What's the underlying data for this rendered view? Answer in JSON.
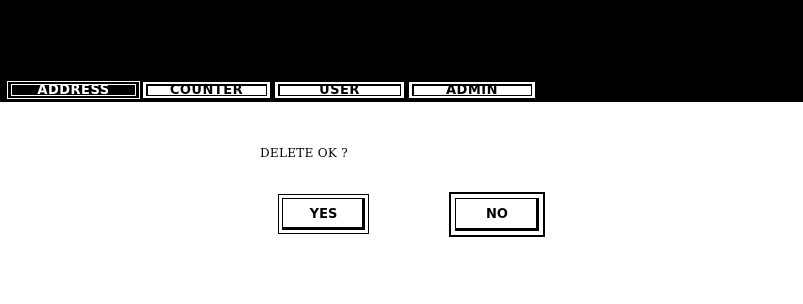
{
  "tabs": [
    {
      "label": "ADDRESS",
      "active": true
    },
    {
      "label": "COUNTER",
      "active": false
    },
    {
      "label": "USER",
      "active": false
    },
    {
      "label": "ADMIN",
      "active": false
    }
  ],
  "dialog": {
    "message": "DELETE OK ?",
    "yes_label": "YES",
    "no_label": "NO"
  }
}
